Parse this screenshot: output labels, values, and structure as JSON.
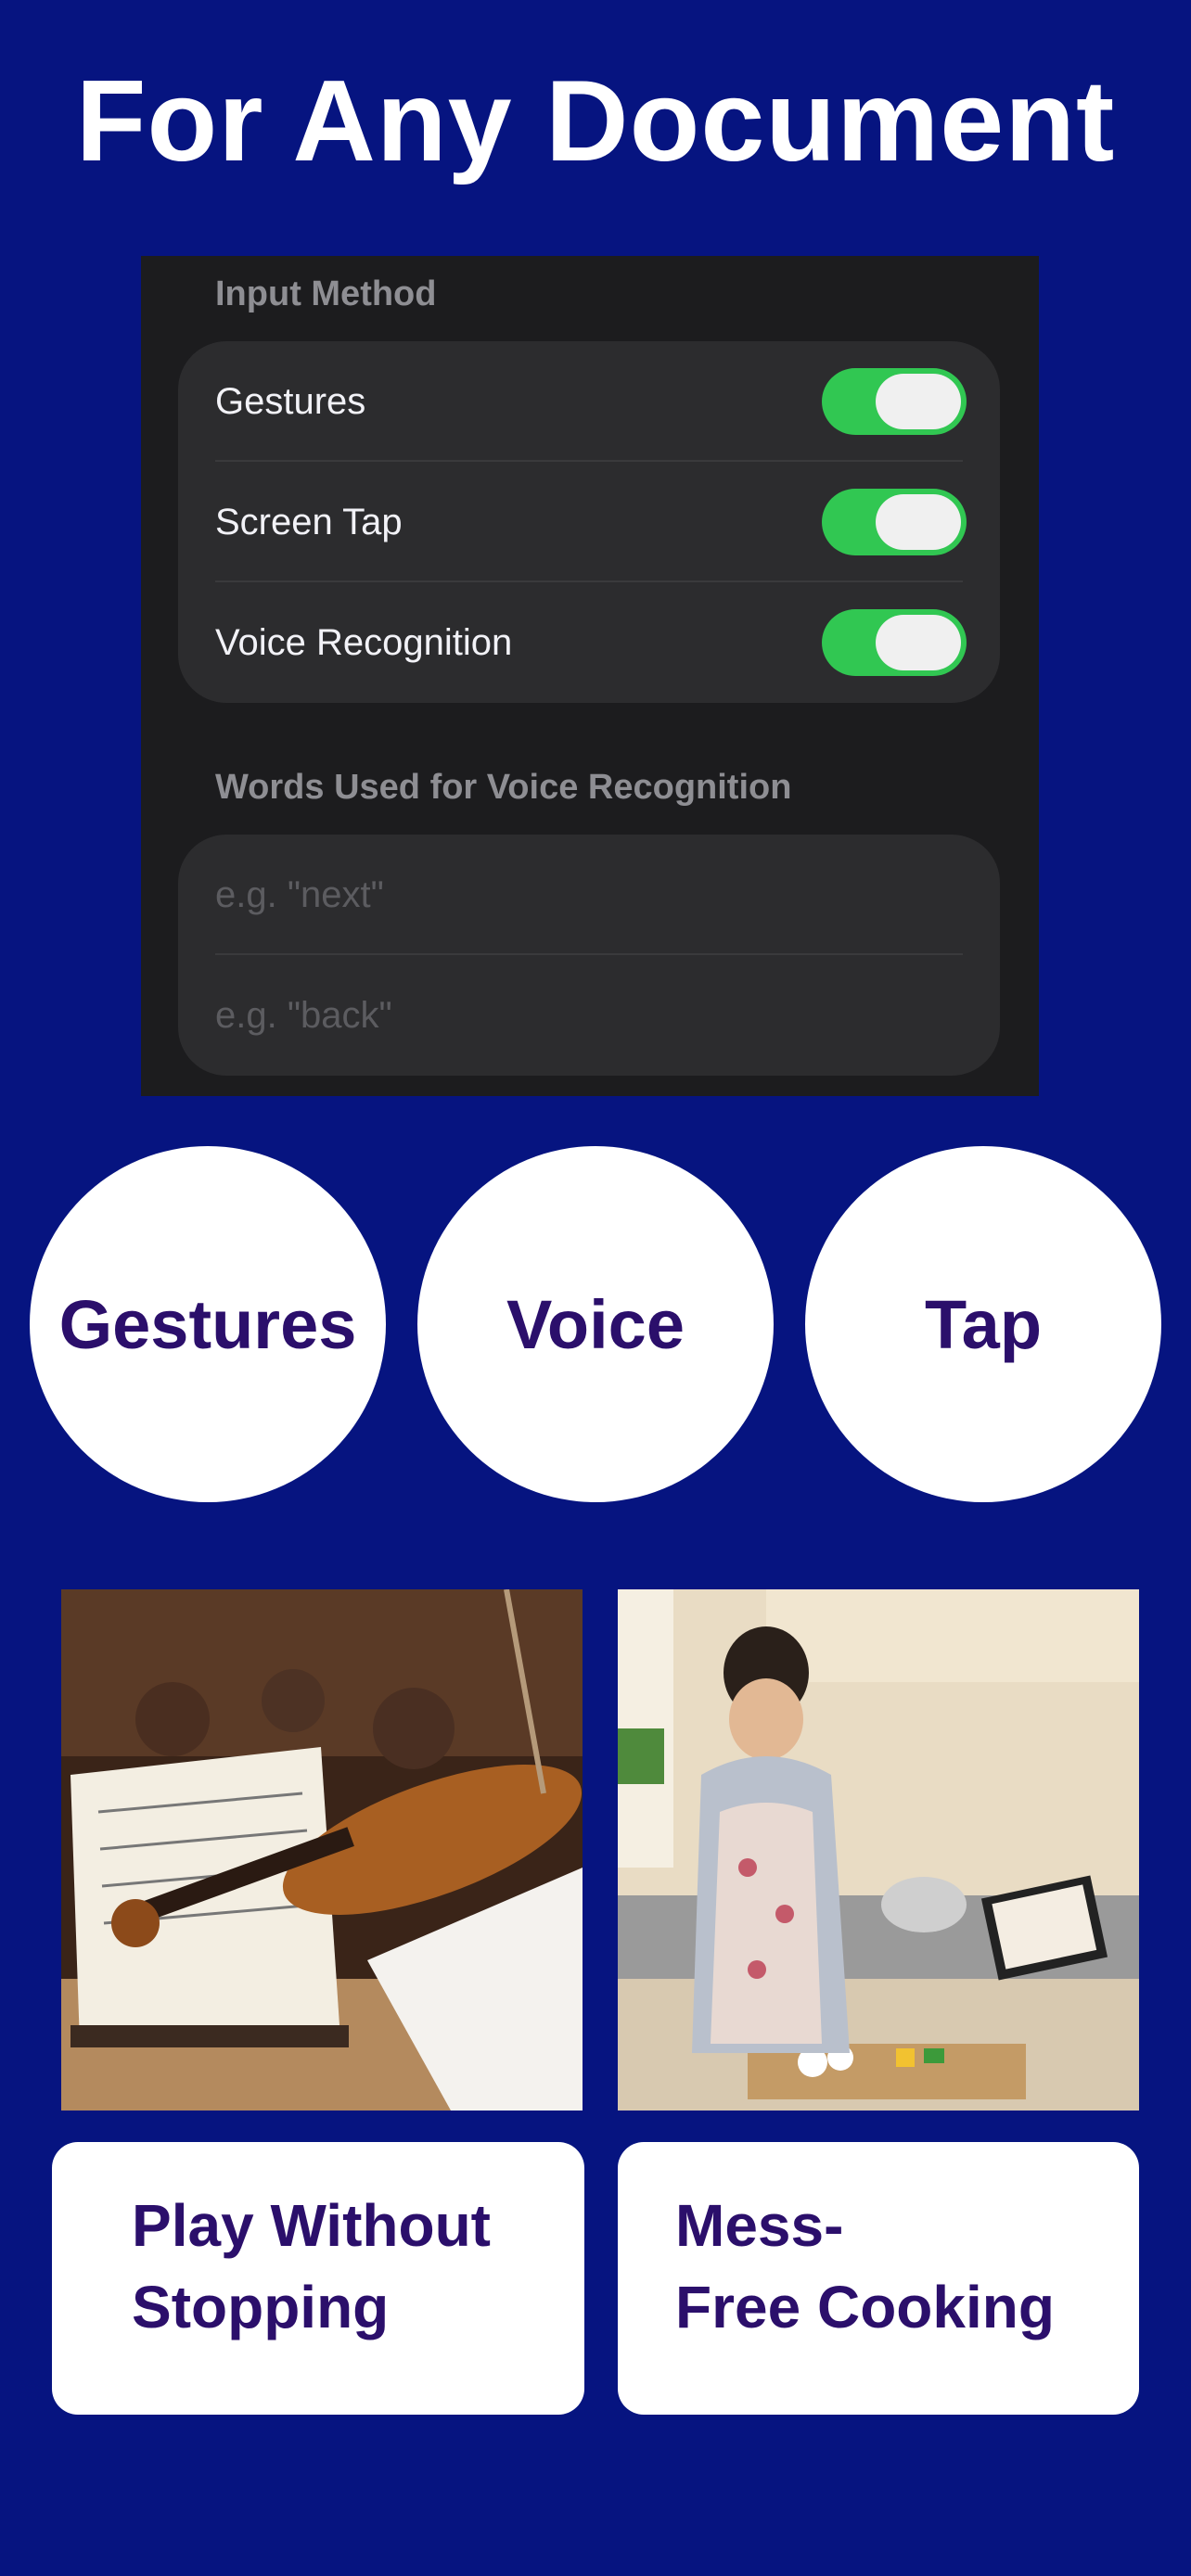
{
  "headline": "For Any Document",
  "settings": {
    "input_method_header": "Input Method",
    "toggles": [
      {
        "label": "Gestures",
        "on": true
      },
      {
        "label": "Screen Tap",
        "on": true
      },
      {
        "label": "Voice Recognition",
        "on": true
      }
    ],
    "words_header": "Words Used for Voice Recognition",
    "word_fields": [
      {
        "placeholder": "e.g. \"next\""
      },
      {
        "placeholder": "e.g. \"back\""
      }
    ]
  },
  "modes": [
    "Gestures",
    "Voice",
    "Tap"
  ],
  "cards": [
    {
      "line1": "Play Without",
      "line2": "Stopping"
    },
    {
      "line1": "Mess-",
      "line2": "Free Cooking"
    }
  ],
  "colors": {
    "background": "#061480",
    "panel": "#1c1c1e",
    "toggle_on": "#31c752",
    "card_text": "#2b0f6b"
  }
}
